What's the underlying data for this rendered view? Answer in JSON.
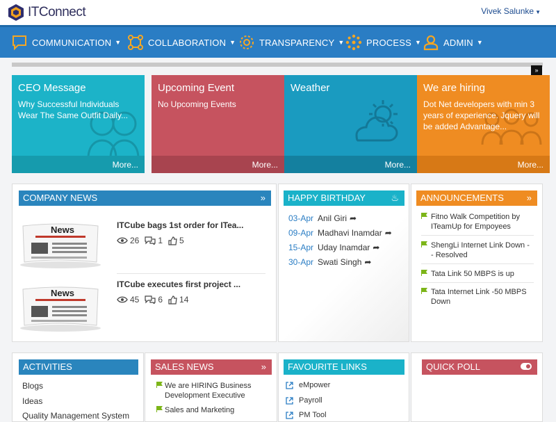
{
  "app": {
    "name": "ITConnect",
    "user": "Vivek Salunke"
  },
  "nav": [
    {
      "label": "COMMUNICATION",
      "icon": "chat-icon"
    },
    {
      "label": "COLLABORATION",
      "icon": "network-icon"
    },
    {
      "label": "TRANSPARENCY",
      "icon": "gear-icon"
    },
    {
      "label": "PROCESS",
      "icon": "process-icon"
    },
    {
      "label": "ADMIN",
      "icon": "user-icon"
    }
  ],
  "tiles": [
    {
      "title": "CEO Message",
      "text": "Why Successful Individuals Wear The Same Outfit Daily...",
      "more": "More...",
      "color": "#1cb3c8"
    },
    {
      "title": "Upcoming Event",
      "text": "No Upcoming Events",
      "more": "More...",
      "color": "#c6535f"
    },
    {
      "title": "Weather",
      "text": "",
      "more": "More...",
      "color": "#1a9bc0"
    },
    {
      "title": "We are hiring",
      "text": "Dot Net developers with min 3 years of experience. Jquery will be added Advantage...",
      "more": "More...",
      "color": "#ef8c22"
    }
  ],
  "company_news": {
    "title": "COMPANY NEWS",
    "image_label": "News",
    "items": [
      {
        "title": "ITCube bags 1st order for ITea...",
        "views": "26",
        "comments": "1",
        "likes": "5"
      },
      {
        "title": "ITCube executes first project ...",
        "views": "45",
        "comments": "6",
        "likes": "14"
      }
    ]
  },
  "birthday": {
    "title": "HAPPY BIRTHDAY",
    "items": [
      {
        "date": "03-Apr",
        "name": "Anil Giri"
      },
      {
        "date": "09-Apr",
        "name": "Madhavi Inamdar"
      },
      {
        "date": "15-Apr",
        "name": "Uday Inamdar"
      },
      {
        "date": "30-Apr",
        "name": "Swati Singh"
      }
    ]
  },
  "announcements": {
    "title": "ANNOUNCEMENTS",
    "items": [
      "Fitno Walk Competition by ITeamUp for Empoyees",
      "ShengLi Internet Link Down -- Resolved",
      "Tata Link 50 MBPS is up",
      "Tata Internet Link -50 MBPS Down"
    ]
  },
  "activities": {
    "title": "ACTIVITIES",
    "items": [
      "Blogs",
      "Ideas",
      "Quality Management System"
    ]
  },
  "sales_news": {
    "title": "SALES NEWS",
    "items": [
      "We are HIRING Business Development Executive",
      "Sales and Marketing"
    ]
  },
  "favourite_links": {
    "title": "FAVOURITE LINKS",
    "items": [
      "eMpower",
      "Payroll",
      "PM Tool"
    ]
  },
  "quick_poll": {
    "title": "QUICK POLL"
  },
  "colors": {
    "nav": "#2a7dc4",
    "teal": "#1cb3c8",
    "red": "#c6535f",
    "orange": "#ef8c22",
    "flag": "#7cb518"
  }
}
